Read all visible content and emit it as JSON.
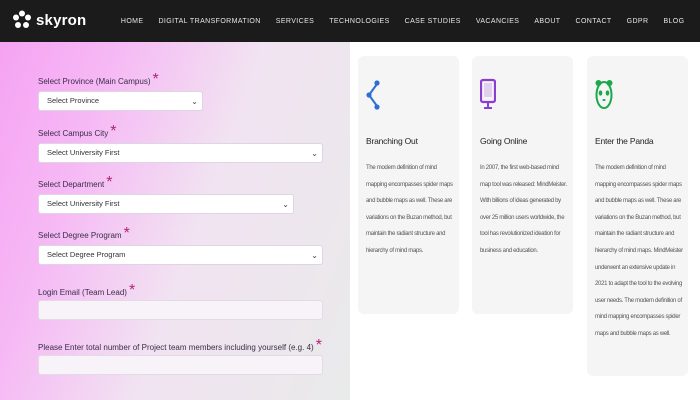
{
  "brand": {
    "name": "skyron"
  },
  "nav": {
    "items": [
      "HOME",
      "DIGITAL TRANSFORMATION",
      "SERVICES",
      "TECHNOLOGIES",
      "CASE STUDIES",
      "VACANCIES",
      "ABOUT",
      "CONTACT",
      "GDPR",
      "BLOG"
    ]
  },
  "form": {
    "province": {
      "label": "Select Province (Main Campus)",
      "value": "Select Province"
    },
    "campus_city": {
      "label": "Select Campus City",
      "value": "Select University First"
    },
    "department": {
      "label": "Select Department",
      "value": "Select University First"
    },
    "degree": {
      "label": "Select Degree Program",
      "value": "Select Degree Program"
    },
    "login_email": {
      "label": "Login Email (Team Lead)",
      "value": ""
    },
    "team_members": {
      "label": "Please Enter total number of Project team members including yourself (e.g. 4)",
      "value": ""
    },
    "required_mark": "*"
  },
  "cards": [
    {
      "icon": "branch-icon",
      "title": "Branching Out",
      "text": "The modern definition of mind mapping encompasses spider maps and bubble maps as well. These are variations on the Buzan method, but maintain the radiant structure and hierarchy of mind maps."
    },
    {
      "icon": "monitor-icon",
      "title": "Going Online",
      "text": "In 2007, the first web-based mind map tool was released: MindMeister. With billions of ideas generated by over 25 million users worldwide, the tool has revolutionized ideation for business and education."
    },
    {
      "icon": "panda-icon",
      "title": "Enter the Panda",
      "text": "The modern definition of mind mapping encompasses spider maps and bubble maps as well. These are variations on the Buzan method, but maintain the radiant structure and hierarchy of mind maps. MindMeister underwent an extensive update in 2021 to adapt the tool to the evolving user needs. The modern definition of mind mapping encompasses spider maps and bubble maps as well."
    }
  ],
  "colors": {
    "header_bg": "#1b1b1b",
    "branch_icon": "#2b6fd6",
    "monitor_icon": "#8a3fd1",
    "panda_icon": "#1aa84a",
    "required": "#b0247a"
  }
}
